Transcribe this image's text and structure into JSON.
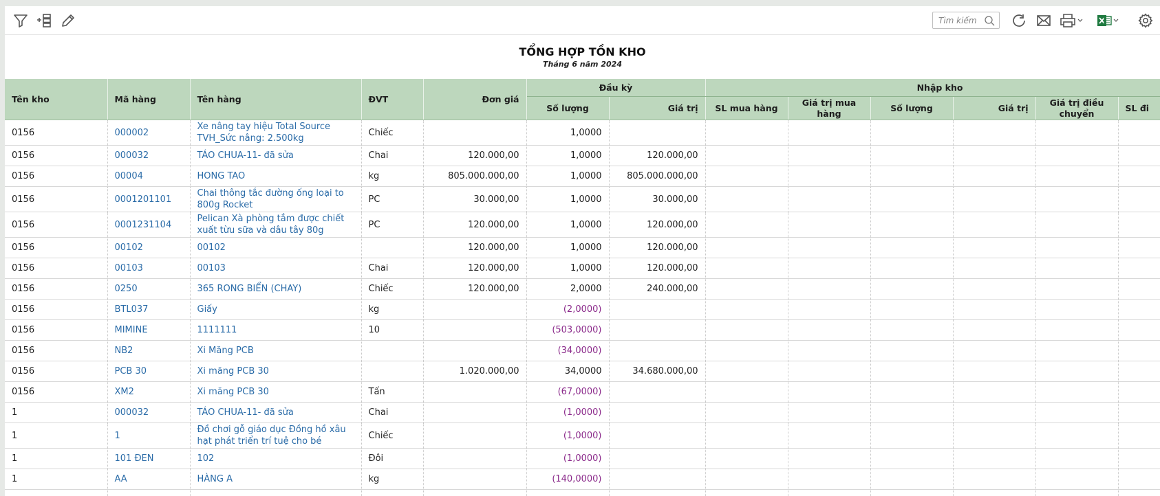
{
  "toolbar": {
    "search_placeholder": "Tìm kiếm"
  },
  "report": {
    "title": "TỔNG HỢP TỒN KHO",
    "subtitle": "Tháng 6 năm 2024"
  },
  "columns": {
    "ten_kho": "Tên kho",
    "ma_hang": "Mã hàng",
    "ten_hang": "Tên hàng",
    "dvt": "ĐVT",
    "don_gia": "Đơn giá",
    "dau_ky": "Đầu kỳ",
    "dau_ky_so_luong": "Số lượng",
    "dau_ky_gia_tri": "Giá trị",
    "nhap_kho": "Nhập kho",
    "sl_mua_hang": "SL mua hàng",
    "gia_tri_mua_hang": "Giá trị mua hàng",
    "nhap_so_luong": "Số lượng",
    "nhap_gia_tri": "Giá trị",
    "gia_tri_dieu_chuyen": "Giá trị điều chuyển",
    "sl_dieu": "SL đi"
  },
  "rows": [
    {
      "kho": "0156",
      "ma": "000002",
      "ten": "Xe nâng tay hiệu Total Source TVH_Sức nâng: 2.500kg",
      "dvt": "Chiếc",
      "don_gia": "",
      "sl": "1,0000",
      "gt": ""
    },
    {
      "kho": "0156",
      "ma": "000032",
      "ten": "TÁO CHUA-11- đã sửa",
      "dvt": "Chai",
      "don_gia": "120.000,00",
      "sl": "1,0000",
      "gt": "120.000,00"
    },
    {
      "kho": "0156",
      "ma": "00004",
      "ten": "HONG TAO",
      "dvt": "kg",
      "don_gia": "805.000.000,00",
      "sl": "1,0000",
      "gt": "805.000.000,00"
    },
    {
      "kho": "0156",
      "ma": "0001201101",
      "ten": "Chai thông tắc đường ống loại to 800g Rocket",
      "dvt": "PC",
      "don_gia": "30.000,00",
      "sl": "1,0000",
      "gt": "30.000,00"
    },
    {
      "kho": "0156",
      "ma": "0001231104",
      "ten": "Pelican Xà phòng tắm được chiết xuất từu sữa và dâu tây 80g",
      "dvt": "PC",
      "don_gia": "120.000,00",
      "sl": "1,0000",
      "gt": "120.000,00"
    },
    {
      "kho": "0156",
      "ma": "00102",
      "ten": "00102",
      "dvt": "",
      "don_gia": "120.000,00",
      "sl": "1,0000",
      "gt": "120.000,00"
    },
    {
      "kho": "0156",
      "ma": "00103",
      "ten": "00103",
      "dvt": "Chai",
      "don_gia": "120.000,00",
      "sl": "1,0000",
      "gt": "120.000,00"
    },
    {
      "kho": "0156",
      "ma": "0250",
      "ten": "365 RONG BIỂN (CHAY)",
      "dvt": "Chiếc",
      "don_gia": "120.000,00",
      "sl": "2,0000",
      "gt": "240.000,00"
    },
    {
      "kho": "0156",
      "ma": "BTL037",
      "ten": "Giấy",
      "dvt": "kg",
      "don_gia": "",
      "sl": "(2,0000)",
      "gt": ""
    },
    {
      "kho": "0156",
      "ma": "MIMINE",
      "ten": "1111111",
      "dvt": "10",
      "don_gia": "",
      "sl": "(503,0000)",
      "gt": ""
    },
    {
      "kho": "0156",
      "ma": "NB2",
      "ten": "Xi Măng PCB",
      "dvt": "",
      "don_gia": "",
      "sl": "(34,0000)",
      "gt": ""
    },
    {
      "kho": "0156",
      "ma": "PCB 30",
      "ten": "Xi măng PCB 30",
      "dvt": "",
      "don_gia": "1.020.000,00",
      "sl": "34,0000",
      "gt": "34.680.000,00"
    },
    {
      "kho": "0156",
      "ma": "XM2",
      "ten": "Xi măng PCB 30",
      "dvt": "Tấn",
      "don_gia": "",
      "sl": "(67,0000)",
      "gt": ""
    },
    {
      "kho": "1",
      "ma": "000032",
      "ten": "TÁO CHUA-11- đã sửa",
      "dvt": "Chai",
      "don_gia": "",
      "sl": "(1,0000)",
      "gt": ""
    },
    {
      "kho": "1",
      "ma": "1",
      "ten": "Đồ chơi gỗ giáo dục Đồng hồ xâu hạt phát triển trí tuệ cho bé",
      "dvt": "Chiếc",
      "don_gia": "",
      "sl": "(1,0000)",
      "gt": ""
    },
    {
      "kho": "1",
      "ma": "101 ĐEN",
      "ten": "102",
      "dvt": "Đôi",
      "don_gia": "",
      "sl": "(1,0000)",
      "gt": ""
    },
    {
      "kho": "1",
      "ma": "AA",
      "ten": "HÀNG A",
      "dvt": "kg",
      "don_gia": "",
      "sl": "(140,0000)",
      "gt": ""
    },
    {
      "kho": "",
      "ma": "",
      "ten": "",
      "dvt": "",
      "don_gia": "",
      "sl": "",
      "gt": ""
    }
  ],
  "colors": {
    "header_bg": "#bdd7bd",
    "link": "#2b6ca8",
    "negative": "#8b2a8b"
  }
}
